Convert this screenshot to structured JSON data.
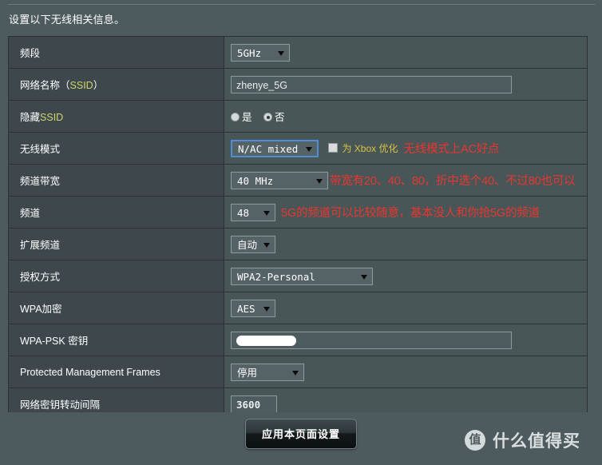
{
  "page": {
    "intro": "设置以下无线相关信息。"
  },
  "rows": {
    "band": {
      "label": "频段",
      "value": "5GHz"
    },
    "ssid": {
      "label_prefix": "网络名称（",
      "label_hl": "SSID",
      "label_suffix": "）",
      "value": "zhenye_5G"
    },
    "hide_ssid": {
      "label_prefix": "隐藏",
      "label_hl": "SSID",
      "options": [
        {
          "text": "是",
          "checked": false
        },
        {
          "text": "否",
          "checked": true
        }
      ]
    },
    "wireless_mode": {
      "label": "无线模式",
      "value": "N/AC mixed",
      "checkbox_label": "为 Xbox 优化",
      "checkbox_checked": false,
      "note": "无线模式上AC好点"
    },
    "bandwidth": {
      "label": "频道带宽",
      "value": "40 MHz",
      "note": "带宽有20、40、80，折中选个40、不过80也可以"
    },
    "channel": {
      "label": "频道",
      "value": "48",
      "note": "5G的频道可以比较随意，基本没人和你抢5G的频道"
    },
    "ext_channel": {
      "label": "扩展频道",
      "value": "自动"
    },
    "auth_method": {
      "label": "授权方式",
      "value": "WPA2-Personal"
    },
    "wpa_encryption": {
      "label": "WPA加密",
      "value": "AES"
    },
    "psk_key": {
      "label": "WPA-PSK 密钥",
      "value": ""
    },
    "pmf": {
      "label": "Protected Management Frames",
      "value": "停用"
    },
    "key_rotation": {
      "label": "网络密钥转动间隔",
      "value": "3600"
    }
  },
  "footer": {
    "apply_button": "应用本页面设置",
    "watermark_badge": "值",
    "watermark_text": "什么值得买"
  },
  "colors": {
    "page_bg": "#4d5a5e",
    "label_bg": "#3e484c",
    "value_bg": "#495658",
    "border": "#2b3134",
    "note_red": "#e8362f",
    "highlight_yellow": "#d8c342",
    "focus_blue": "#4f8ed6"
  }
}
